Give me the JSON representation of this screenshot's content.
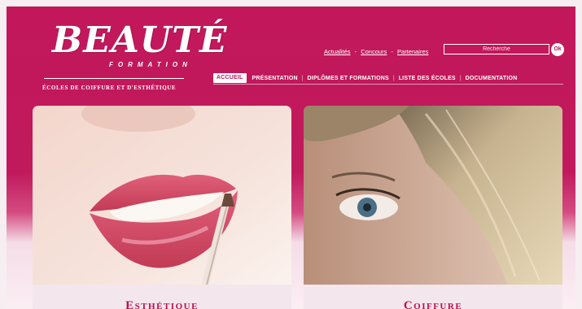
{
  "logo": {
    "brand": "BEAUTÉ",
    "sub": "FORMATION",
    "tagline": "ÉCOLES DE COIFFURE ET D'ESTHÉTIQUE"
  },
  "top_links": [
    "Actualités",
    "Concours",
    "Partenaires"
  ],
  "top_link_separator": "-",
  "search": {
    "placeholder": "Recherche",
    "button": "Ok"
  },
  "nav": {
    "items": [
      "ACCUEIL",
      "PRÉSENTATION",
      "DIPLÔMES ET FORMATIONS",
      "LISTE DES ÉCOLES",
      "DOCUMENTATION"
    ],
    "separator": "|",
    "active_index": 0
  },
  "cards": [
    {
      "title": "Esthétique",
      "image": "lips-with-lip-brush-photo"
    },
    {
      "title": "Coiffure",
      "image": "blonde-hair-woman-eye-photo"
    }
  ],
  "colors": {
    "brand": "#c2175b",
    "title": "#b8104f",
    "footer": "#f3e6ec"
  }
}
